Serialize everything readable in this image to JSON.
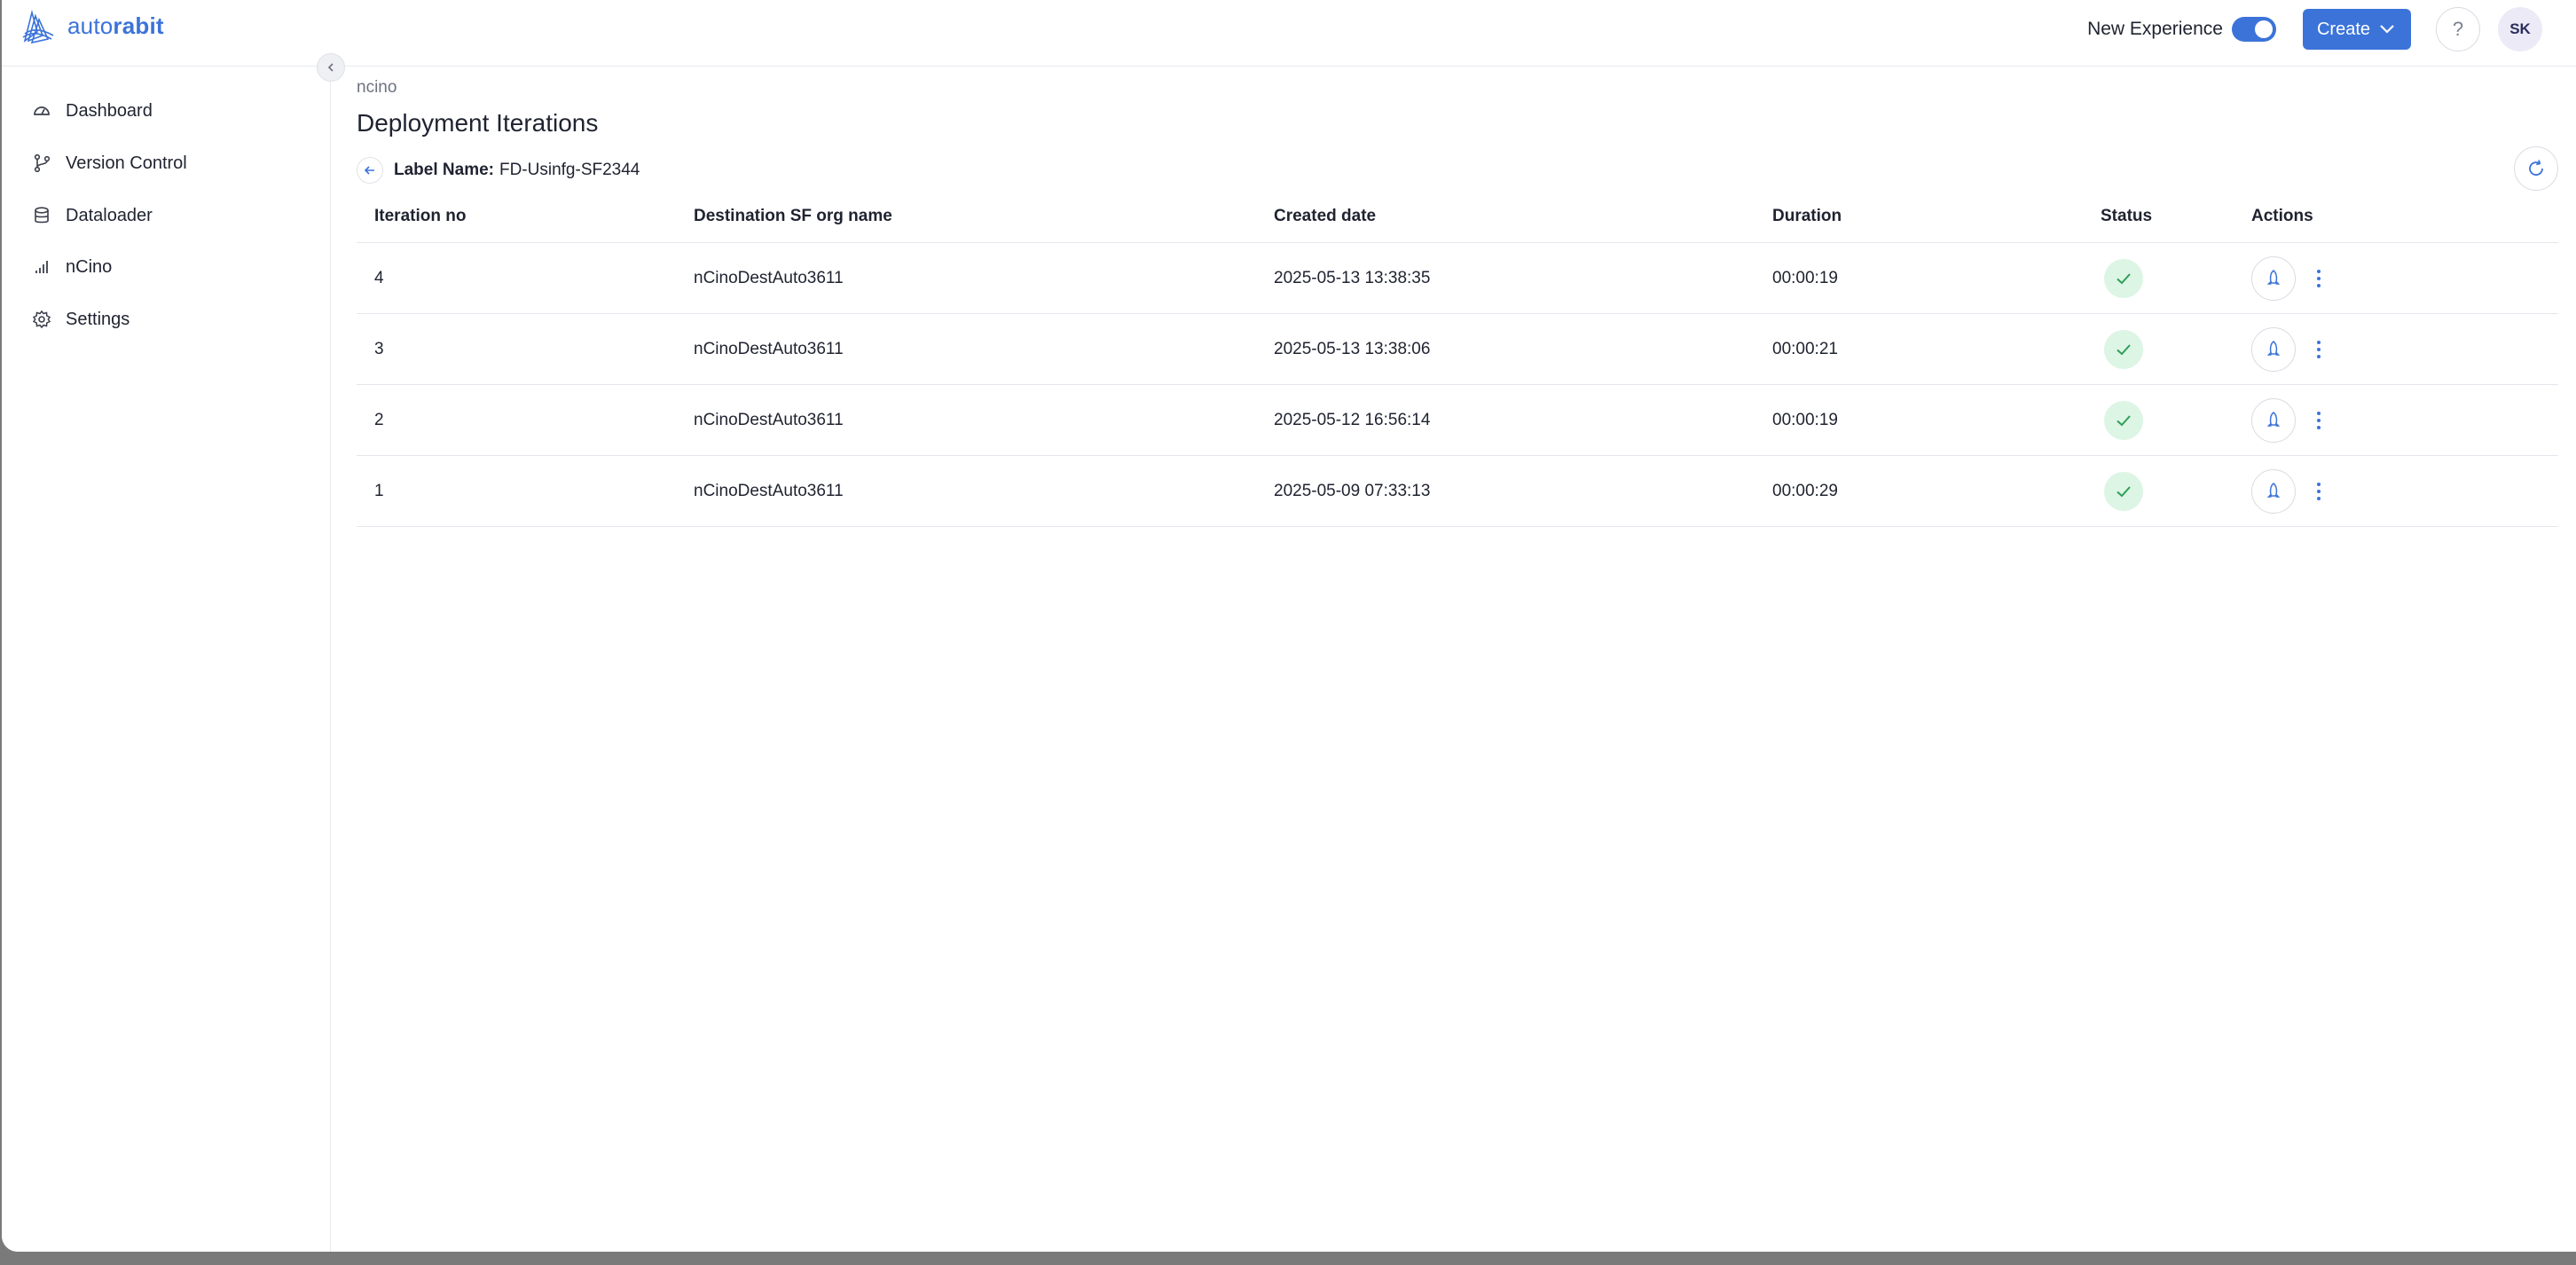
{
  "app": {
    "logo_text_light": "auto",
    "logo_text_bold": "rabit",
    "brand_color": "#3b73d9"
  },
  "header": {
    "new_experience_label": "New Experience",
    "new_experience_on": true,
    "create_label": "Create",
    "help_icon": "question-mark-icon",
    "avatar_initials": "SK"
  },
  "sidebar": {
    "items": [
      {
        "label": "Dashboard",
        "icon": "dashboard-icon"
      },
      {
        "label": "Version Control",
        "icon": "git-branch-icon"
      },
      {
        "label": "Dataloader",
        "icon": "database-icon"
      },
      {
        "label": "nCino",
        "icon": "bar-chart-icon"
      },
      {
        "label": "Settings",
        "icon": "gear-icon"
      }
    ]
  },
  "main": {
    "breadcrumb": "ncino",
    "title": "Deployment Iterations",
    "label_key": "Label Name:",
    "label_value": "FD-Usinfg-SF2344",
    "table": {
      "headers": [
        "Iteration no",
        "Destination SF org name",
        "Created date",
        "Duration",
        "Status",
        "Actions"
      ],
      "rows": [
        {
          "iteration": "4",
          "org": "nCinoDestAuto3611",
          "created": "2025-05-13 13:38:35",
          "duration": "00:00:19",
          "status": "success"
        },
        {
          "iteration": "3",
          "org": "nCinoDestAuto3611",
          "created": "2025-05-13 13:38:06",
          "duration": "00:00:21",
          "status": "success"
        },
        {
          "iteration": "2",
          "org": "nCinoDestAuto3611",
          "created": "2025-05-12 16:56:14",
          "duration": "00:00:19",
          "status": "success"
        },
        {
          "iteration": "1",
          "org": "nCinoDestAuto3611",
          "created": "2025-05-09 07:33:13",
          "duration": "00:00:29",
          "status": "success"
        }
      ]
    }
  }
}
